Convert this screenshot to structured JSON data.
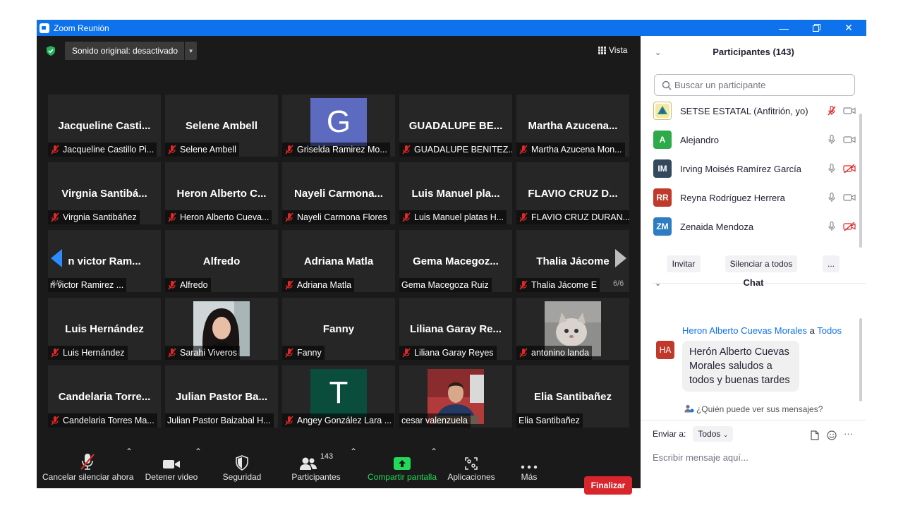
{
  "window": {
    "title": "Zoom Reunión"
  },
  "top": {
    "sound_label": "Sonido original: desactivado",
    "view_label": "Vista"
  },
  "gallery": {
    "page": "6/6",
    "tiles": [
      {
        "big": "Jacqueline  Casti...",
        "label": "Jacqueline Castillo Pi...",
        "muted": true
      },
      {
        "big": "Selene Ambell",
        "label": "Selene Ambell",
        "muted": true
      },
      {
        "big": "",
        "avatar": "G",
        "avatar_color": "#5c6bc0",
        "label": "Griselda Ramirez Mo...",
        "muted": true
      },
      {
        "big": "GUADALUPE BE...",
        "label": "GUADALUPE BENITEZ...",
        "muted": true
      },
      {
        "big": "Martha  Azucena...",
        "label": "Martha Azucena Mon...",
        "muted": true
      },
      {
        "big": "Virgnia  Santibá...",
        "label": "Virgnia Santibáñez",
        "muted": true
      },
      {
        "big": "Heron Alberto C...",
        "label": "Heron Alberto Cueva...",
        "muted": true
      },
      {
        "big": "Nayeli  Carmona...",
        "label": "Nayeli Carmona Flores",
        "muted": true
      },
      {
        "big": "Luis Manuel pla...",
        "label": "Luis Manuel platas H...",
        "muted": true
      },
      {
        "big": "FLAVIO CRUZ D...",
        "label": "FLAVIO CRUZ DURAN...",
        "muted": true
      },
      {
        "big": "n victor Ram...",
        "label": "n victor Ramirez ...",
        "muted": false
      },
      {
        "big": "Alfredo",
        "label": "Alfredo",
        "muted": true
      },
      {
        "big": "Adriana Matla",
        "label": "Adriana Matla",
        "muted": true
      },
      {
        "big": "Gema  Macegoz...",
        "label": "Gema Macegoza Ruiz",
        "muted": false
      },
      {
        "big": "Thalia Jácome",
        "label": "Thalia Jácome E",
        "muted": true
      },
      {
        "big": "Luis Hernández",
        "label": "Luis Hernández",
        "muted": true
      },
      {
        "big": "",
        "photo": "woman",
        "label": "Sarahi Viveros",
        "muted": true
      },
      {
        "big": "Fanny",
        "label": "Fanny",
        "muted": true
      },
      {
        "big": "Liliana Garay Re...",
        "label": "Liliana Garay Reyes",
        "muted": true
      },
      {
        "big": "",
        "photo": "cat",
        "label": "antonino landa",
        "muted": true
      },
      {
        "big": "Candelaria  Torre...",
        "label": "Candelaria Torres Ma...",
        "muted": true
      },
      {
        "big": "Julian Pastor Ba...",
        "label": "Julian Pastor Baizabal H...",
        "muted": false
      },
      {
        "big": "",
        "avatar": "T",
        "avatar_color": "#0b4d3c",
        "label": "Angey González Lara ...",
        "muted": true
      },
      {
        "big": "",
        "photo": "man",
        "label": "cesar valenzuela",
        "muted": false
      },
      {
        "big": "Elia Santibañez",
        "label": "Elia Santibañez",
        "muted": false
      }
    ]
  },
  "toolbar": {
    "unmute": "Cancelar silenciar ahora",
    "video": "Detener video",
    "security": "Seguridad",
    "participants": "Participantes",
    "participants_count": "143",
    "share": "Compartir pantalla",
    "apps": "Aplicaciones",
    "more": "Más",
    "end": "Finalizar"
  },
  "participants_panel": {
    "title": "Participantes (143)",
    "search_placeholder": "Buscar un participante",
    "rows": [
      {
        "initials": "",
        "name": "SETSE ESTATAL (Anfitrión, yo)",
        "color": "#ffffff",
        "mic": "muted",
        "cam": "on"
      },
      {
        "initials": "A",
        "name": "Alejandro",
        "color": "#2eaa4a",
        "mic": "on",
        "cam": "on"
      },
      {
        "initials": "IM",
        "name": "Irving Moisés Ramírez García",
        "color": "#34495e",
        "mic": "on",
        "cam": "off"
      },
      {
        "initials": "RR",
        "name": "Reyna Rodríguez Herrera",
        "color": "#c0392b",
        "mic": "on",
        "cam": "on"
      },
      {
        "initials": "ZM",
        "name": "Zenaida Mendoza",
        "color": "#2e7dc1",
        "mic": "on",
        "cam": "off"
      }
    ],
    "invite": "Invitar",
    "mute_all": "Silenciar a todos",
    "more": "..."
  },
  "chat": {
    "title": "Chat",
    "from": "Heron Alberto Cuevas Morales",
    "to_word": "a",
    "to": "Todos",
    "avatar": "HA",
    "message": "Herón Alberto Cuevas Morales saludos a todos y buenas tardes",
    "who_can_see": "¿Quién puede ver sus mensajes?",
    "send_to_label": "Enviar a:",
    "send_to_value": "Todos",
    "input_placeholder": "Escribir mensaje aquí..."
  },
  "colors": {
    "accent": "#0e72ed",
    "end": "#d9262c",
    "share": "#23d959",
    "muted_icon": "#e02828"
  }
}
